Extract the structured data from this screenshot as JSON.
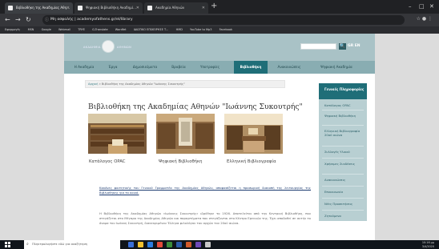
{
  "browser": {
    "tabs": [
      {
        "label": "Βιβλιοθήκη της Ακαδημίας Αθη..."
      },
      {
        "label": "Ψηφιακή Βιβλιοθήκη Ακαδημί..."
      },
      {
        "label": "Ακαδημία Αθηνών"
      }
    ],
    "new_tab_symbol": "+",
    "url": "Μη ασφαλής | academyofathens.gr/el/library",
    "bookmarks": [
      "Εφαρμογές",
      "MSN",
      "Google",
      "Webmail",
      "TRYE",
      "G-Translate",
      "Wordfet",
      "ΙΔΙΩΤΙΚΟ ΕΠΙΧΕΙΡΗΣΕ Τ...",
      "HMD",
      "YouTube to Mp3",
      "Facebook"
    ]
  },
  "site": {
    "logo_left": "ΑΚΑΔΗΜΙΑ",
    "logo_right": "ΑΘΗΝΩΝ",
    "search_button": "🔍",
    "lang": "GR EN",
    "nav": [
      "Η Ακαδημία",
      "Έργα",
      "Δημοσιεύματα",
      "Βραβεία",
      "Υποτροφίες",
      "Βιβλιοθήκη",
      "Ανακοινώσεις",
      "Ψηφιακή Ακαδημία"
    ],
    "breadcrumb": {
      "home": "Αρχική",
      "path": "» Βιβλιοθήκη της Ακαδημίας Αθηνών \"Ιωάννης Συκουτρής\""
    },
    "title": "Βιβλιοθήκη της Ακαδημίας Αθηνών \"Ιωάννης Συκουτρής\"",
    "thumbs": [
      {
        "caption": "Κατάλογος OPAC"
      },
      {
        "caption": "Ψηφιακή Βιβλιοθήκη"
      },
      {
        "caption": "Ελληνική Βιβλιογραφία"
      }
    ],
    "intro": "Κανόνες φοιτητικής του Γενικού Γραμματέα της Ακαδημίας Αθηνών, αποφασίζεται η προσωρινή διακοπή της λειτουργίας της Βιβλιοθήκης για το κοινό.",
    "paragraph": "Η Βιβλιοθήκη της Ακαδημίας Αθηνών «Ιωάννης Συκουτρής» ιδρύθηκε το 1926. Αποτελείται από την Κεντρική Βιβλιοθήκη, που στεγάζεται στο Μέγαρο της Ακαδημίας Αθηνών και παραρτήματα που στεγάζονται στο Κέντρο Ερευνών της. Έχει αποδοθεί σε αυτήν το όνομα του Ιωάννη Συκουτρή, διακεκριμένου Έλληνα φιλολόγου του αρχών του 20ού αιώνα.",
    "sidebar": {
      "header": "Γενικές Πληροφορίες",
      "items": [
        "Κατάλογος OPAC",
        "Ψηφιακή Βιβλιοθήκη",
        "Ελληνική Βιβλιογραφία 20ού αιώνα",
        "Συλλογές Υλικού",
        "Χρήσιμες Συνδέσεις",
        "Ανακοινώσεις",
        "Επικοινωνία",
        "Νέες Προσκτήσεις",
        "Ζητούμενα"
      ]
    }
  },
  "taskbar": {
    "search_placeholder": "Πληκτρολογήστε εδώ για αναζήτηση",
    "time": "10:16 μμ",
    "date": "3/4/2020"
  },
  "colors": {
    "header_bg": "#a9c2c6",
    "nav_bg": "#89adb2",
    "accent": "#1f6e78",
    "sidebar_bg": "#b8cfd2"
  }
}
